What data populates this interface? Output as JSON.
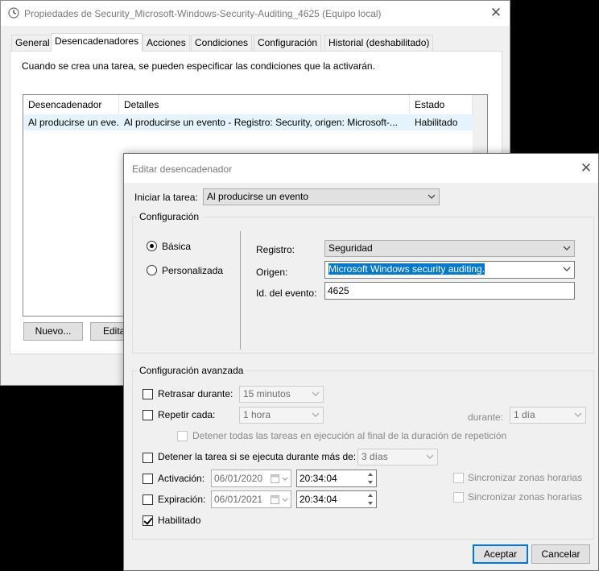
{
  "main_window": {
    "title": "Propiedades de Security_Microsoft-Windows-Security-Auditing_4625 (Equipo local)",
    "close_glyph": "✕",
    "tabs": [
      {
        "label": "General"
      },
      {
        "label": "Desencadenadores"
      },
      {
        "label": "Acciones"
      },
      {
        "label": "Condiciones"
      },
      {
        "label": "Configuración"
      },
      {
        "label": "Historial (deshabilitado)"
      }
    ],
    "selected_tab": "Desencadenadores",
    "description": "Cuando se crea una tarea, se pueden especificar las condiciones que la activarán.",
    "triggers_table": {
      "columns": [
        "Desencadenador",
        "Detalles",
        "Estado"
      ],
      "rows": [
        {
          "trigger": "Al producirse un evento",
          "trigger_display": "Al producirse un eve...",
          "details": "Al producirse un evento - Registro: Security, origen: Microsoft-...",
          "status": "Habilitado"
        }
      ]
    },
    "buttons": {
      "new": "Nuevo...",
      "edit": "Editar"
    }
  },
  "edit_dialog": {
    "title": "Editar desencadenador",
    "close_glyph": "✕",
    "begin_task_label": "Iniciar la tarea:",
    "begin_task_value": "Al producirse un evento",
    "settings_group": "Configuración",
    "radio_basic": "Básica",
    "radio_custom": "Personalizada",
    "selected_mode": "Básica",
    "log_label": "Registro:",
    "log_value": "Seguridad",
    "source_label": "Origen:",
    "source_value": "Microsoft Windows security auditing.",
    "event_id_label": "Id. del evento:",
    "event_id_value": "4625",
    "advanced_group": "Configuración avanzada",
    "delay_label": "Retrasar durante:",
    "delay_value": "15 minutos",
    "repeat_label": "Repetir cada:",
    "repeat_value": "1 hora",
    "duration_label": "durante:",
    "duration_value": "1 día",
    "stop_all_label": "Detener todas las tareas en ejecución al final de la duración de repetición",
    "stop_if_label": "Detener la tarea si se ejecuta durante más de:",
    "stop_if_value": "3 días",
    "activation_label": "Activación:",
    "activation_date": "06/01/2020",
    "activation_time": "20:34:04",
    "expiration_label": "Expiración:",
    "expiration_date": "06/01/2021",
    "expiration_time": "20:34:04",
    "sync_label": "Sincronizar zonas horarias",
    "enabled_label": "Habilitado",
    "ok_button": "Aceptar",
    "cancel_button": "Cancelar",
    "checkbox_states": {
      "delay": false,
      "repeat": false,
      "stop_all": false,
      "stop_if": false,
      "activation": false,
      "expiration": false,
      "sync_activation": false,
      "sync_expiration": false,
      "enabled": true
    }
  },
  "colors": {
    "window_bg": "#f0f0f0",
    "selection_highlight": "#0078d7",
    "row_highlight": "#e5f3ff",
    "ok_button_border": "#0078d7",
    "desktop": "#000000"
  },
  "icons": [
    "scheduler-clock-icon",
    "close-icon",
    "dropdown-arrow-icon",
    "calendar-icon",
    "spin-up-icon",
    "spin-down-icon"
  ]
}
